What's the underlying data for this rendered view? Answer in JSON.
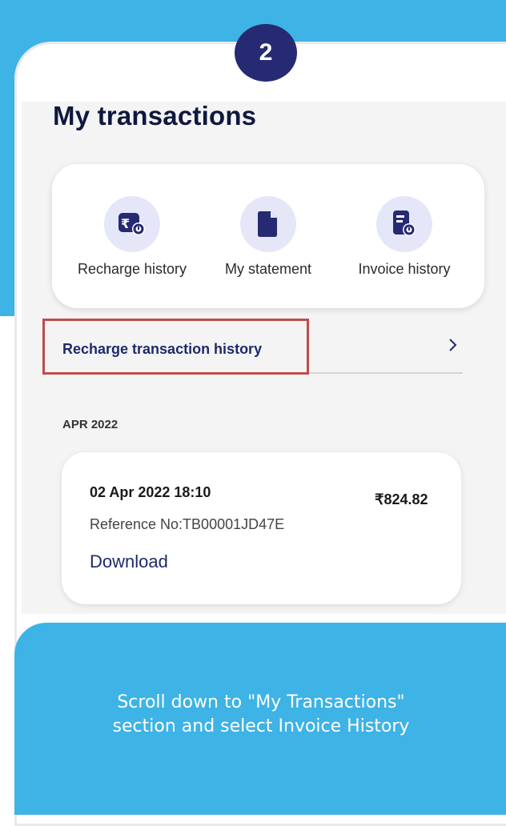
{
  "step_badge": "2",
  "screen": {
    "title": "My transactions",
    "quick_actions": [
      {
        "label": "Recharge history",
        "icon": "rupee-receipt-icon"
      },
      {
        "label": "My statement",
        "icon": "document-icon"
      },
      {
        "label": "Invoice history",
        "icon": "invoice-icon"
      }
    ],
    "recharge_link": "Recharge transaction history",
    "month_header": "APR 2022",
    "transaction": {
      "datetime": "02 Apr 2022 18:10",
      "amount": "₹824.82",
      "reference": "Reference No:TB00001JD47E",
      "download_label": "Download"
    }
  },
  "instruction": {
    "line1": "Scroll down to \"My Transactions\"",
    "line2": "section and select Invoice History"
  },
  "colors": {
    "background_blue": "#3db3e6",
    "badge_navy": "#262a73",
    "accent_navy": "#1f2a6b",
    "highlight_red": "#c14b4b",
    "icon_circle": "#e5e7f9"
  }
}
